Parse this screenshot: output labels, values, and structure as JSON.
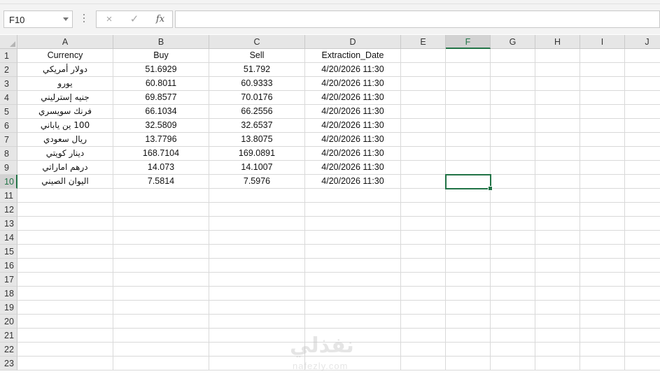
{
  "formula_bar": {
    "name_box": "F10",
    "cancel_icon": "×",
    "enter_icon": "✓",
    "fx_label": "fx",
    "formula_value": ""
  },
  "sheet": {
    "columns": [
      "A",
      "B",
      "C",
      "D",
      "E",
      "F",
      "G",
      "H",
      "I",
      "J"
    ],
    "row_numbers": [
      "1",
      "2",
      "3",
      "4",
      "5",
      "6",
      "7",
      "8",
      "9",
      "10",
      "11",
      "12",
      "13",
      "14",
      "15",
      "16",
      "17",
      "18",
      "19",
      "20",
      "21",
      "22",
      "23"
    ],
    "headers": [
      "Currency",
      "Buy",
      "Sell",
      "Extraction_Date"
    ],
    "rows": [
      [
        "دولار أمريكي",
        "51.6929",
        "51.792",
        "4/20/2026 11:30"
      ],
      [
        "يورو",
        "60.8011",
        "60.9333",
        "4/20/2026 11:30"
      ],
      [
        "جنيه إسترليني",
        "69.8577",
        "70.0176",
        "4/20/2026 11:30"
      ],
      [
        "فرنك سويسري",
        "66.1034",
        "66.2556",
        "4/20/2026 11:30"
      ],
      [
        "100 ين ياباني",
        "32.5809",
        "32.6537",
        "4/20/2026 11:30"
      ],
      [
        "ريال سعودي",
        "13.7796",
        "13.8075",
        "4/20/2026 11:30"
      ],
      [
        "دينار كويتي",
        "168.7104",
        "169.0891",
        "4/20/2026 11:30"
      ],
      [
        "درهم اماراتي",
        "14.073",
        "14.1007",
        "4/20/2026 11:30"
      ],
      [
        "اليوان الصيني",
        "7.5814",
        "7.5976",
        "4/20/2026 11:30"
      ]
    ],
    "selected_cell": "F10",
    "selected_column": "F",
    "selected_row": "10",
    "accent_color": "#217346"
  },
  "watermark": {
    "arabic": "نفذلي",
    "latin": "nafezly.com"
  }
}
